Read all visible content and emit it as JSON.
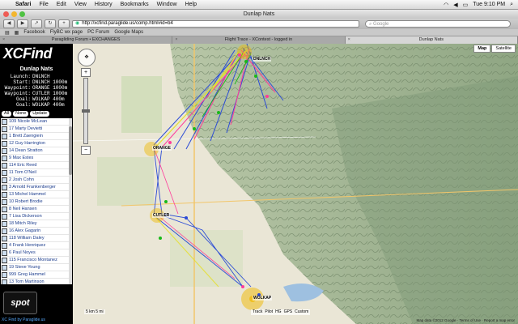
{
  "menubar": {
    "app": "Safari",
    "items": [
      "File",
      "Edit",
      "View",
      "History",
      "Bookmarks",
      "Window",
      "Help"
    ],
    "clock": "Tue 9:10 PM"
  },
  "window": {
    "title": "Dunlap Nats"
  },
  "toolbar": {
    "url": "http://xcfind.paraglide.us/comp.html#id=b4",
    "search_placeholder": "Google"
  },
  "bookmarks": [
    "Facebook",
    "FlyBC wx page",
    "PC Forum",
    "Google Maps"
  ],
  "tabs": [
    {
      "label": "Paragliding Forum • EXCHANGES"
    },
    {
      "label": "Flight Trace - XContest - logged in"
    },
    {
      "label": "Dunlap Nats",
      "active": true
    }
  ],
  "sidebar": {
    "logo": "XCFind",
    "event_title": "Dunlap Nats",
    "info": [
      {
        "k": "Launch:",
        "v": "DNLNCH"
      },
      {
        "k": "Start:",
        "v": "DNLNCH 1000m"
      },
      {
        "k": "Waypoint:",
        "v": "ORANGE 1000m"
      },
      {
        "k": "Waypoint:",
        "v": "CUTLER 1000m"
      },
      {
        "k": "Goal:",
        "v": "WOLKAP 400m"
      },
      {
        "k": "Goal:",
        "v": "WOLKAP 400m"
      }
    ],
    "buttons": [
      "All",
      "None",
      "Update"
    ],
    "pilots": [
      "109 Nicole McLean",
      "17 Marty Devietti",
      "1 Brett Zaengiein",
      "12 Guy Harrington",
      "14 Dean Stratton",
      "9 Max Estes",
      "114 Eric Reed",
      "11 Tom O'Neil",
      "2 Josh Cohn",
      "3 Arnold Frankenberger",
      "13 Michel Hammel",
      "10 Robert Brodie",
      "8 Neil Hansen",
      "7 Lisa Dickerson",
      "18 Mitch Riley",
      "16 Alex Gagarin",
      "118 William Daley",
      "4 Frank Henriquez",
      "6 Paul Noyes",
      "115 Francisco Montanez",
      "19 Steve Young",
      "999 Greg Hammel",
      "13 Tom Martinson",
      "110 Tom Rhook",
      "10 Rayne Carlson"
    ],
    "spot_logo": "spot",
    "bottom_link": "XC Find by Paraglide.us"
  },
  "map": {
    "types": [
      "Map",
      "Satellite"
    ],
    "active_type": "Map",
    "waypoints": [
      "DNLNCH",
      "ORANGE",
      "CUTLER",
      "WOLKAP"
    ],
    "legend": [
      "Track",
      "Pilot",
      "HG",
      "GPS",
      "Custom"
    ],
    "scale_text": "5 km  5 mi",
    "attribution": "Map data ©2012 Google · Terms of Use · Report a map error",
    "colors": {
      "track_blue": "#2b4bd6",
      "track_pink": "#ff3b9a",
      "track_yellow": "#e6e02a",
      "track_green": "#19b919",
      "waypoint": "#f0b800"
    }
  }
}
